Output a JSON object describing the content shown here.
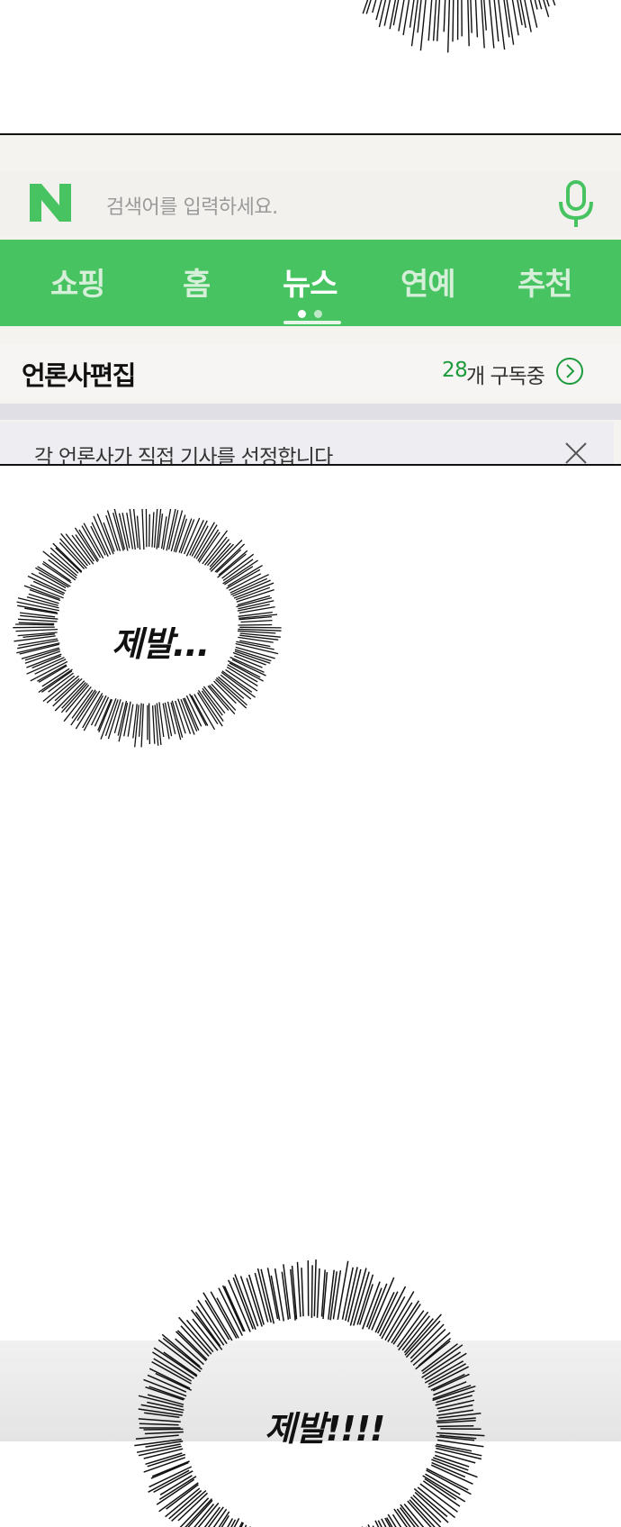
{
  "app": {
    "logo_letter": "N",
    "search_placeholder": "검색어를 입력하세요.",
    "tabs": [
      {
        "label": "쇼핑",
        "active": false
      },
      {
        "label": "홈",
        "active": false
      },
      {
        "label": "뉴스",
        "active": true
      },
      {
        "label": "연예",
        "active": false
      },
      {
        "label": "추천",
        "active": false
      }
    ],
    "page_indicator": {
      "count": 2,
      "current": 1
    },
    "section_title": "언론사편집",
    "subscription_count": "28",
    "subscription_suffix": "개 구독중",
    "notice_text": "각 언론사가 직접 기사를 선정합니다",
    "icons": {
      "mic": "microphone-icon",
      "arrow": "chevron-right-circle-icon",
      "close": "close-icon"
    },
    "colors": {
      "brand_green": "#47c461",
      "count_green": "#1c9b3d"
    }
  },
  "speech": {
    "bubble_1": "제발...",
    "bubble_2": "제발!!!!"
  }
}
